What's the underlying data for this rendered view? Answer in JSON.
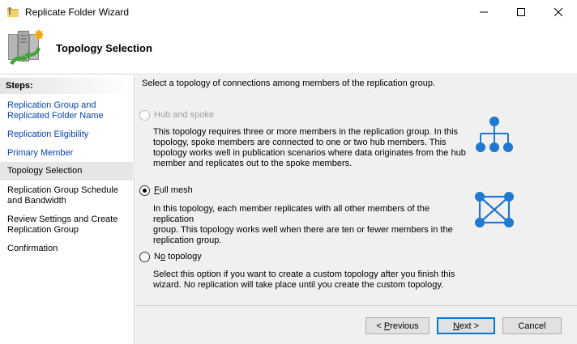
{
  "window": {
    "title": "Replicate Folder Wizard",
    "icons": {
      "app": "replicate-folder-icon",
      "minimize": "minimize-icon",
      "maximize": "maximize-icon",
      "close": "close-icon"
    }
  },
  "header": {
    "page_title": "Topology Selection",
    "icon": "replication-servers-icon"
  },
  "steps": {
    "header": "Steps:",
    "items": [
      {
        "line1": "Replication Group and",
        "line2": "Replicated Folder Name",
        "state": "link"
      },
      {
        "line1": "Replication Eligibility",
        "line2": "",
        "state": "link"
      },
      {
        "line1": "Primary Member",
        "line2": "",
        "state": "link"
      },
      {
        "line1": "Topology Selection",
        "line2": "",
        "state": "current"
      },
      {
        "line1": "Replication Group Schedule",
        "line2": "and Bandwidth",
        "state": "pending"
      },
      {
        "line1": "Review Settings and Create",
        "line2": "Replication Group",
        "state": "pending"
      },
      {
        "line1": "Confirmation",
        "line2": "",
        "state": "pending"
      }
    ]
  },
  "main": {
    "intro": "Select a topology of connections among members of the replication group.",
    "options": [
      {
        "label": "Hub and spoke",
        "mnemonic": "",
        "selected": false,
        "enabled": false,
        "icon": "hub-and-spoke-topology-icon",
        "desc": [
          "This topology requires three or more members in the replication group. In this",
          "topology, spoke members are connected to one or two hub members. This",
          "topology works well in publication scenarios where data originates from the hub",
          "member and replicates out to the spoke members."
        ]
      },
      {
        "label_mnemonic": "F",
        "label_rest": "ull mesh",
        "selected": true,
        "enabled": true,
        "icon": "full-mesh-topology-icon",
        "desc": [
          "In this topology, each member replicates with all other members of the replication",
          "group. This topology works well when there are ten or fewer members in the",
          "replication group."
        ]
      },
      {
        "label_pre": "N",
        "label_mnemonic": "o",
        "label_rest": " topology",
        "selected": false,
        "enabled": true,
        "desc": [
          "Select this option if you want to create a custom topology after you finish this",
          "wizard. No replication will take place until you create the custom topology."
        ]
      }
    ],
    "accent_color": "#1f78d1"
  },
  "footer": {
    "previous_pre": "< ",
    "previous_mnemonic": "P",
    "previous_rest": "revious",
    "next_mnemonic": "N",
    "next_rest": "ext >",
    "cancel": "Cancel"
  }
}
